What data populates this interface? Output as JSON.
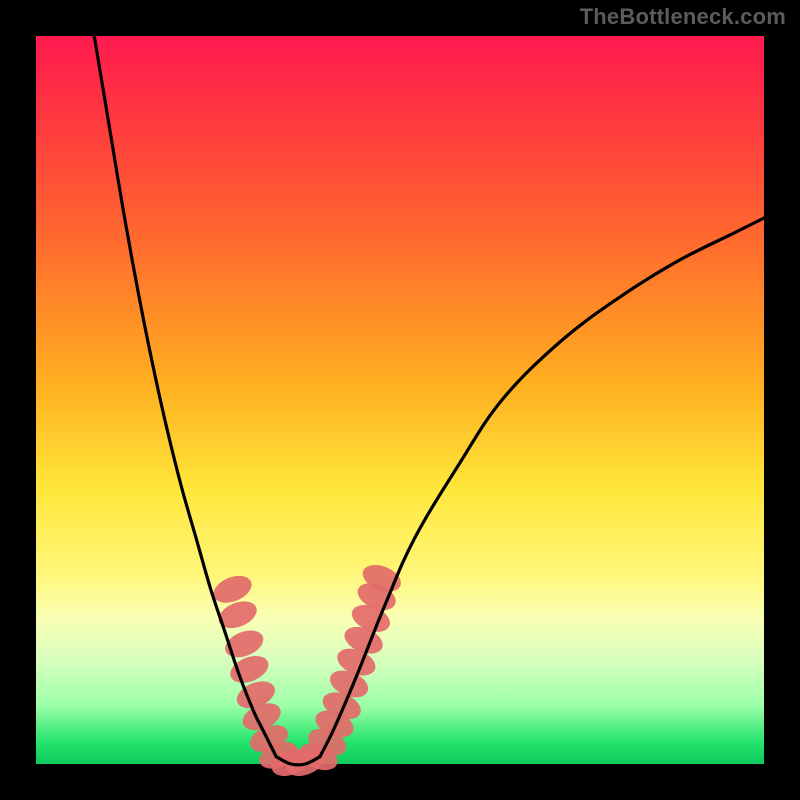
{
  "attribution": "TheBottleneck.com",
  "chart_data": {
    "type": "line",
    "title": "",
    "xlabel": "",
    "ylabel": "",
    "xlim": [
      0,
      100
    ],
    "ylim": [
      0,
      100
    ],
    "series": [
      {
        "name": "left-curve",
        "x": [
          8,
          10,
          12,
          14,
          16,
          18,
          20,
          22,
          24,
          26,
          28,
          30,
          31,
          32,
          33
        ],
        "y": [
          100,
          88,
          76,
          65,
          55,
          46,
          38,
          31,
          24,
          18,
          12,
          7,
          5,
          3,
          1
        ]
      },
      {
        "name": "valley-floor",
        "x": [
          33,
          35,
          37,
          39
        ],
        "y": [
          1,
          0,
          0,
          1
        ]
      },
      {
        "name": "right-curve",
        "x": [
          39,
          41,
          44,
          48,
          52,
          58,
          64,
          72,
          80,
          88,
          96,
          100
        ],
        "y": [
          1,
          5,
          12,
          22,
          31,
          41,
          50,
          58,
          64,
          69,
          73,
          75
        ]
      }
    ],
    "markers": [
      {
        "series": "left-lobe-markers",
        "x": 27.0,
        "y": 24.0
      },
      {
        "series": "left-lobe-markers",
        "x": 27.7,
        "y": 20.5
      },
      {
        "series": "left-lobe-markers",
        "x": 28.6,
        "y": 16.5
      },
      {
        "series": "left-lobe-markers",
        "x": 29.3,
        "y": 13.0
      },
      {
        "series": "left-lobe-markers",
        "x": 30.2,
        "y": 9.5
      },
      {
        "series": "left-lobe-markers",
        "x": 31.0,
        "y": 6.5
      },
      {
        "series": "left-lobe-markers",
        "x": 32.0,
        "y": 3.5
      },
      {
        "series": "left-lobe-markers",
        "x": 33.3,
        "y": 1.2
      },
      {
        "series": "left-lobe-markers",
        "x": 35.0,
        "y": 0.2
      },
      {
        "series": "left-lobe-markers",
        "x": 37.0,
        "y": 0.2
      },
      {
        "series": "right-lobe-markers",
        "x": 38.8,
        "y": 1.0
      },
      {
        "series": "right-lobe-markers",
        "x": 40.0,
        "y": 3.0
      },
      {
        "series": "right-lobe-markers",
        "x": 41.0,
        "y": 5.5
      },
      {
        "series": "right-lobe-markers",
        "x": 42.0,
        "y": 8.0
      },
      {
        "series": "right-lobe-markers",
        "x": 43.0,
        "y": 11.0
      },
      {
        "series": "right-lobe-markers",
        "x": 44.0,
        "y": 14.0
      },
      {
        "series": "right-lobe-markers",
        "x": 45.0,
        "y": 17.0
      },
      {
        "series": "right-lobe-markers",
        "x": 46.0,
        "y": 20.0
      },
      {
        "series": "right-lobe-markers",
        "x": 46.8,
        "y": 23.0
      },
      {
        "series": "right-lobe-markers",
        "x": 47.5,
        "y": 25.5
      }
    ],
    "marker_style": {
      "shape": "capsule",
      "color": "#e36a6a",
      "opacity": 0.92,
      "rx": 12,
      "ry": 20
    },
    "curve_style": {
      "color": "#000000",
      "width": 3.2
    },
    "background": "rainbow-vertical",
    "grid": false,
    "legend": false
  },
  "icons": {}
}
